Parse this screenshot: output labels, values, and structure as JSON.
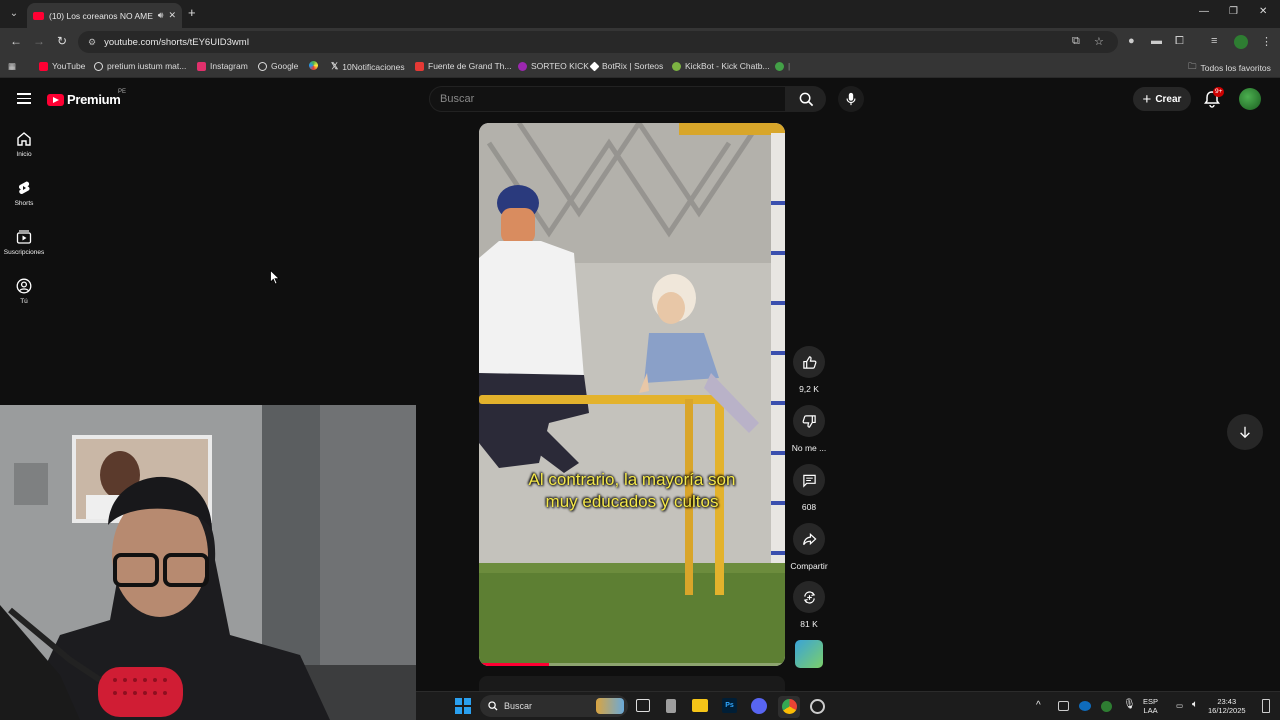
{
  "browser": {
    "tab": {
      "title": "(10) Los coreanos NO AME",
      "sound_icon": "speaker-icon",
      "close_icon": "close-icon"
    },
    "new_tab_icon": "plus-icon",
    "window_controls": [
      "minimize-icon",
      "restore-icon",
      "close-icon"
    ],
    "url": "youtube.com/shorts/tEY6UID3wmI",
    "bookmarks": [
      {
        "label": "YouTube",
        "color": "#ff0033"
      },
      {
        "label": "pretium iustum mat...",
        "color": "#e0e0e0"
      },
      {
        "label": "Instagram",
        "color": "#e1306c"
      },
      {
        "label": "Google",
        "color": "#e0e0e0"
      },
      {
        "label": "",
        "color": "#4caf50"
      },
      {
        "label": "10Notificaciones",
        "color": "#ffffff"
      },
      {
        "label": "Fuente de Grand Th...",
        "color": "#e53935"
      },
      {
        "label": "SORTEO KICK",
        "color": "#9c27b0"
      },
      {
        "label": "BotRix | Sorteos",
        "color": "#ffffff"
      },
      {
        "label": "KickBot - Kick Chatb...",
        "color": "#7cb342"
      },
      {
        "label": "",
        "color": "#43a047"
      }
    ],
    "bookmarks_folder": "Todos los favoritos"
  },
  "youtube": {
    "brand": "Premium",
    "region": "PE",
    "search_placeholder": "Buscar",
    "create_label": "Crear",
    "notification_badge": "9+",
    "sidebar": [
      {
        "label": "Inicio",
        "icon": "home-icon"
      },
      {
        "label": "Shorts",
        "icon": "shorts-icon"
      },
      {
        "label": "Suscripciones",
        "icon": "subscriptions-icon"
      },
      {
        "label": "Tú",
        "icon": "user-icon"
      }
    ],
    "short": {
      "subtitle_line1": "Al contrario, la mayoría son",
      "subtitle_line2": "muy educados y cultos",
      "progress": 0.23
    },
    "actions": {
      "likes": "9,2 K",
      "dislike_label": "No me ...",
      "comments": "608",
      "share_label": "Compartir",
      "remix_count": "81 K"
    }
  },
  "taskbar": {
    "search_label": "Buscar",
    "lang_line1": "ESP",
    "lang_line2": "LAA",
    "time": "23:43",
    "date": "16/12/2025",
    "accent": "#0078d4"
  }
}
